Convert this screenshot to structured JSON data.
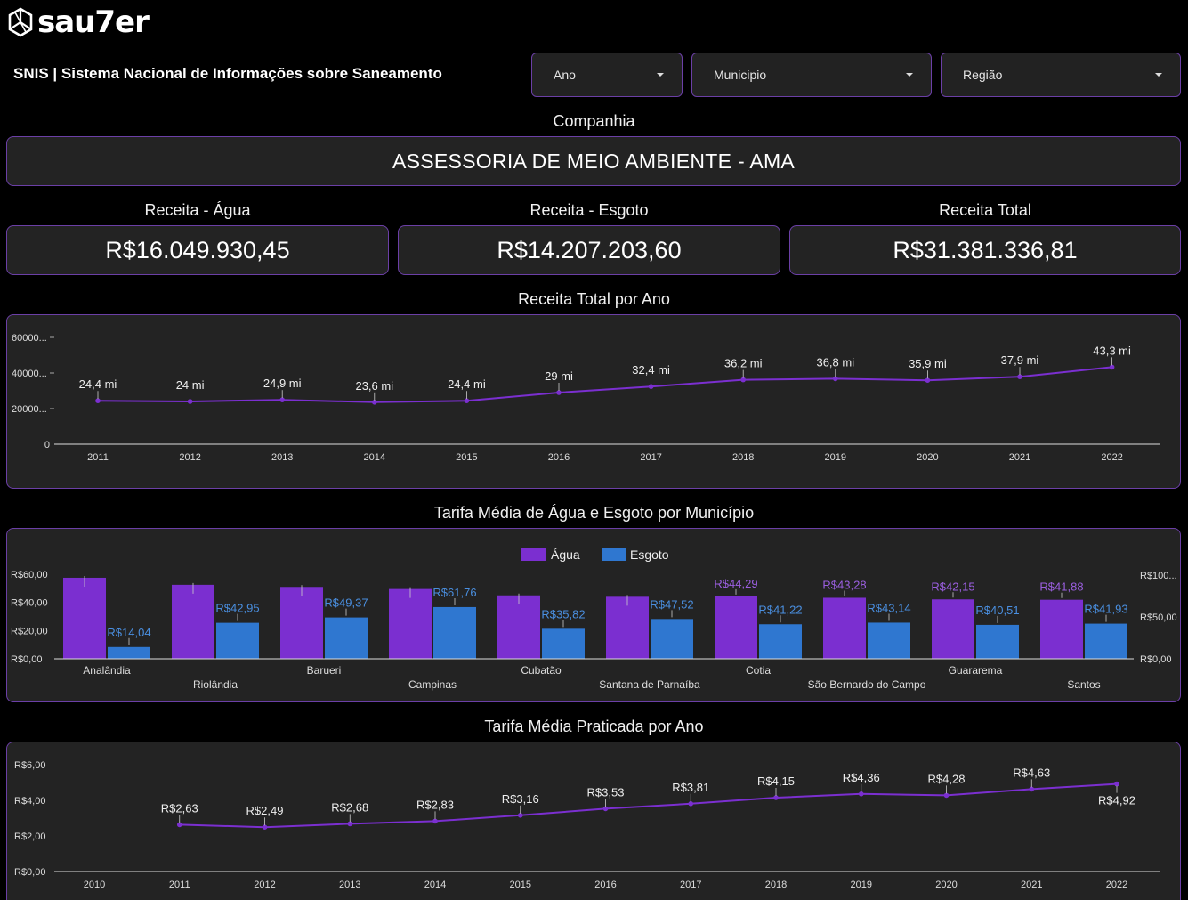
{
  "brand": {
    "logo_text": "sau7er",
    "logo_icon": "hexagon-logo-icon"
  },
  "header": {
    "title": "SNIS | Sistema Nacional de Informações sobre Saneamento"
  },
  "filters": [
    {
      "label": "Ano"
    },
    {
      "label": "Municipio"
    },
    {
      "label": "Região"
    }
  ],
  "company": {
    "label": "Companhia",
    "value": "ASSESSORIA DE MEIO AMBIENTE - AMA"
  },
  "kpis": [
    {
      "label": "Receita - Água",
      "value": "R$16.049.930,45"
    },
    {
      "label": "Receita - Esgoto",
      "value": "R$14.207.203,60"
    },
    {
      "label": "Receita Total",
      "value": "R$31.381.336,81"
    }
  ],
  "colors": {
    "accent": "#7b2fd0",
    "agua": "#7b2fd0",
    "esgoto": "#2f77d0",
    "border": "#6b3fa6",
    "card": "#232323"
  },
  "chart_data": [
    {
      "id": "receita-ano",
      "type": "line",
      "title": "Receita Total por Ano",
      "x": [
        "2011",
        "2012",
        "2013",
        "2014",
        "2015",
        "2016",
        "2017",
        "2018",
        "2019",
        "2020",
        "2021",
        "2022"
      ],
      "series": [
        {
          "values": [
            24.4,
            24,
            24.9,
            23.6,
            24.4,
            29,
            32.4,
            36.2,
            36.8,
            35.9,
            37.9,
            43.3
          ]
        }
      ],
      "data_labels": [
        "24,4 mi",
        "24 mi",
        "24,9 mi",
        "23,6 mi",
        "24,4 mi",
        "29 mi",
        "32,4 mi",
        "36,2 mi",
        "36,8 mi",
        "35,9 mi",
        "37,9 mi",
        "43,3 mi"
      ],
      "y_ticks": [
        "0",
        "20000...",
        "40000...",
        "60000..."
      ],
      "ylim": [
        0,
        60
      ],
      "grid": false
    },
    {
      "id": "tarifa-municipio",
      "type": "bar",
      "title": "Tarifa Média de Água e Esgoto por Município",
      "categories": [
        "Analândia",
        "Riolândia",
        "Barueri",
        "Campinas",
        "Cubatão",
        "Santana de Parnaíba",
        "Cotia",
        "São Bernardo do Campo",
        "Guararema",
        "Santos"
      ],
      "series": [
        {
          "name": "Água",
          "axis": "left",
          "values": [
            57.5,
            52.5,
            51,
            49.5,
            45,
            44,
            44.29,
            43.28,
            42.15,
            41.88
          ],
          "labels": [
            "",
            "",
            "",
            "",
            "",
            "",
            "R$44,29",
            "R$43,28",
            "R$42,15",
            "R$41,88"
          ]
        },
        {
          "name": "Esgoto",
          "axis": "right",
          "values": [
            14.04,
            42.95,
            49.37,
            61.76,
            35.82,
            47.52,
            41.22,
            43.14,
            40.51,
            41.93
          ],
          "labels": [
            "R$14,04",
            "R$42,95",
            "R$49,37",
            "R$61,76",
            "R$35,82",
            "R$47,52",
            "R$41,22",
            "R$43,14",
            "R$40,51",
            "R$41,93"
          ]
        }
      ],
      "y_ticks_left": [
        "R$0,00",
        "R$20,00",
        "R$40,00",
        "R$60,00"
      ],
      "y_ticks_right": [
        "R$0,00",
        "R$50,00",
        "R$100..."
      ],
      "ylim_left": [
        0,
        60
      ],
      "ylim_right": [
        0,
        100
      ],
      "legend": "top-center"
    },
    {
      "id": "tarifa-ano",
      "type": "line",
      "title": "Tarifa Média Praticada por Ano",
      "x": [
        "2010",
        "2011",
        "2012",
        "2013",
        "2014",
        "2015",
        "2016",
        "2017",
        "2018",
        "2019",
        "2020",
        "2021",
        "2022"
      ],
      "series": [
        {
          "values": [
            null,
            2.63,
            2.49,
            2.68,
            2.83,
            3.16,
            3.53,
            3.81,
            4.15,
            4.36,
            4.28,
            4.63,
            4.92
          ]
        }
      ],
      "data_labels": [
        "",
        "R$2,63",
        "R$2,49",
        "R$2,68",
        "R$2,83",
        "R$3,16",
        "R$3,53",
        "R$3,81",
        "R$4,15",
        "R$4,36",
        "R$4,28",
        "R$4,63",
        "R$4,92"
      ],
      "y_ticks": [
        "R$0,00",
        "R$2,00",
        "R$4,00",
        "R$6,00"
      ],
      "ylim": [
        0,
        6
      ],
      "grid": false
    }
  ]
}
